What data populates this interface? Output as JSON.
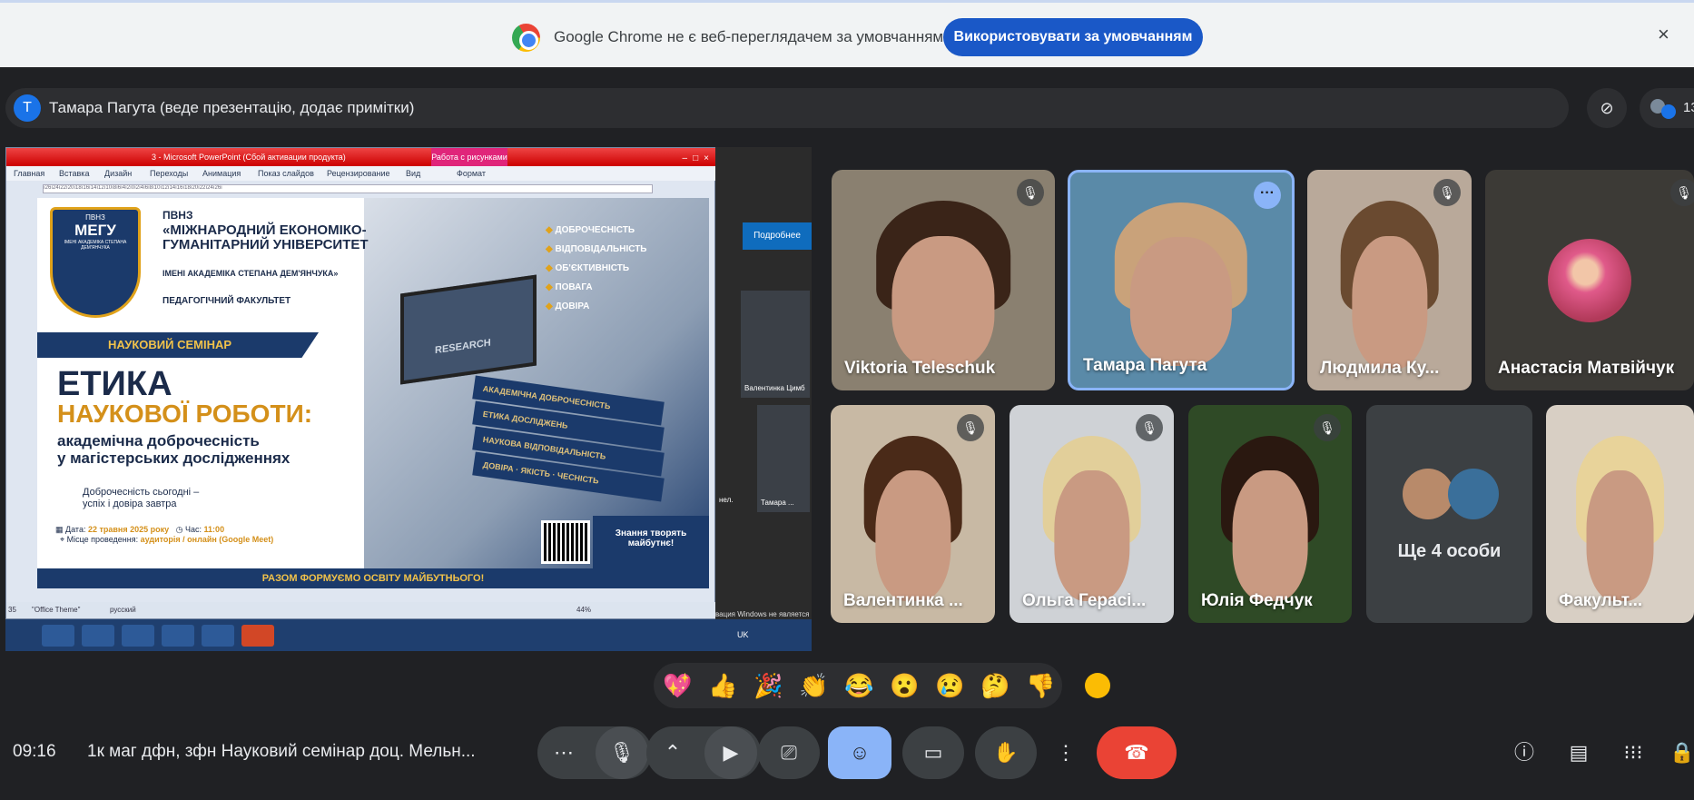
{
  "banner": {
    "message": "Google Chrome не є веб-переглядачем за умовчанням",
    "button": "Використовувати за умовчанням",
    "close": "×"
  },
  "presenter": {
    "avatar_letter": "T",
    "label": "Тамара Пагута (веде презентацію, додає примітки)"
  },
  "participant_count": "13",
  "shared_screen": {
    "ppt_title": "3 - Microsoft PowerPoint (Сбой активации продукта)",
    "ppt_context_tab": "Работа с рисунками",
    "ppt_menu": [
      "Главная",
      "Вставка",
      "Дизайн",
      "Переходы",
      "Анимация",
      "Показ слайдов",
      "Рецензирование",
      "Вид",
      "Формат"
    ],
    "ruler": "ı26ı24ı22ı20ı18ı16ı14ı12ı10ı8ı6ı4ı2ı0ı2ı4ı6ı8ı10ı12ı14ı16ı18ı20ı22ı24ı26ı",
    "status": {
      "slide": "35",
      "theme": "\"Office Theme\"",
      "lang": "русский",
      "zoom": "44%"
    },
    "slide": {
      "shield_top": "ПВНЗ",
      "shield_mid": "МЕГУ",
      "shield_sub": "ІМЕНІ АКАДЕМІКА СТЕПАНА ДЕМ'ЯНЧУКА",
      "pvnz": "ПВНЗ",
      "university": "«МІЖНАРОДНИЙ ЕКОНОМІКО-ГУМАНІТАРНИЙ УНІВЕРСИТЕТ",
      "university_sub": "ІМЕНІ АКАДЕМІКА СТЕПАНА ДЕМ'ЯНЧУКА»",
      "faculty": "ПЕДАГОГІЧНИЙ ФАКУЛЬТЕТ",
      "values": [
        "ДОБРОЧЕСНІСТЬ",
        "ВІДПОВІДАЛЬНІСТЬ",
        "ОБ'ЄКТИВНІСТЬ",
        "ПОВАГА",
        "ДОВІРА"
      ],
      "seminar": "НАУКОВИЙ СЕМІНАР",
      "heading1": "ЕТИКА",
      "heading2": "НАУКОВОЇ РОБОТИ:",
      "heading3a": "академічна доброчесність",
      "heading3b": "у магістерських дослідженнях",
      "quote_a": "Доброчесність сьогодні –",
      "quote_b": "успіх і довіра завтра",
      "laptop_label": "RESEARCH",
      "books": [
        "АКАДЕМІЧНА ДОБРОЧЕСНІСТЬ",
        "ЕТИКА ДОСЛІДЖЕНЬ",
        "НАУКОВА ВІДПОВІДАЛЬНІСТЬ",
        "ДОВІРА · ЯКІСТЬ · ЧЕСНІСТЬ"
      ],
      "date_label": "Дата:",
      "date_value": "22 травня 2025 року",
      "time_label": "Час:",
      "time_value": "11:00",
      "place_label": "Місце проведення:",
      "place_value": "аудиторія / онлайн (Google Meet)",
      "slogan": "Знання творять майбутнє!",
      "footer": "РАЗОМ ФОРМУЄМО ОСВІТУ МАЙБУТНЬОГО!"
    },
    "bg_window": {
      "button": "Подробнее",
      "tile1": "Валентинка Цимб",
      "tile2": "Тамара ...",
      "tile3": "нел.",
      "notice": "вация Windows не является",
      "tray": "UK"
    }
  },
  "participants": [
    {
      "name": "Viktoria Teleschuk",
      "muted": true
    },
    {
      "name": "Тамара Пагута",
      "muted": false,
      "speaking": true
    },
    {
      "name": "Людмила Ку...",
      "muted": true
    },
    {
      "name": "Анастасія Матвійчук",
      "muted": true
    },
    {
      "name": "Валентинка ...",
      "muted": true
    },
    {
      "name": "Ольга Гераci...",
      "muted": true
    },
    {
      "name": "Юлія Федчук",
      "muted": true
    },
    {
      "name": "Ще 4 особи",
      "muted": false
    },
    {
      "name": "Факульт...",
      "muted": false
    }
  ],
  "reactions": [
    "💖",
    "👍",
    "🎉",
    "👏",
    "😂",
    "😮",
    "😢",
    "🤔",
    "👎"
  ],
  "bottom": {
    "time": "09:16",
    "meeting_title": "1к маг дфн, зфн Науковий семінар доц. Мельн..."
  },
  "colors": {
    "meet_bg": "#202124",
    "accent": "#8ab4f8",
    "end_call": "#ea4335",
    "banner_button": "#1a58c7"
  }
}
